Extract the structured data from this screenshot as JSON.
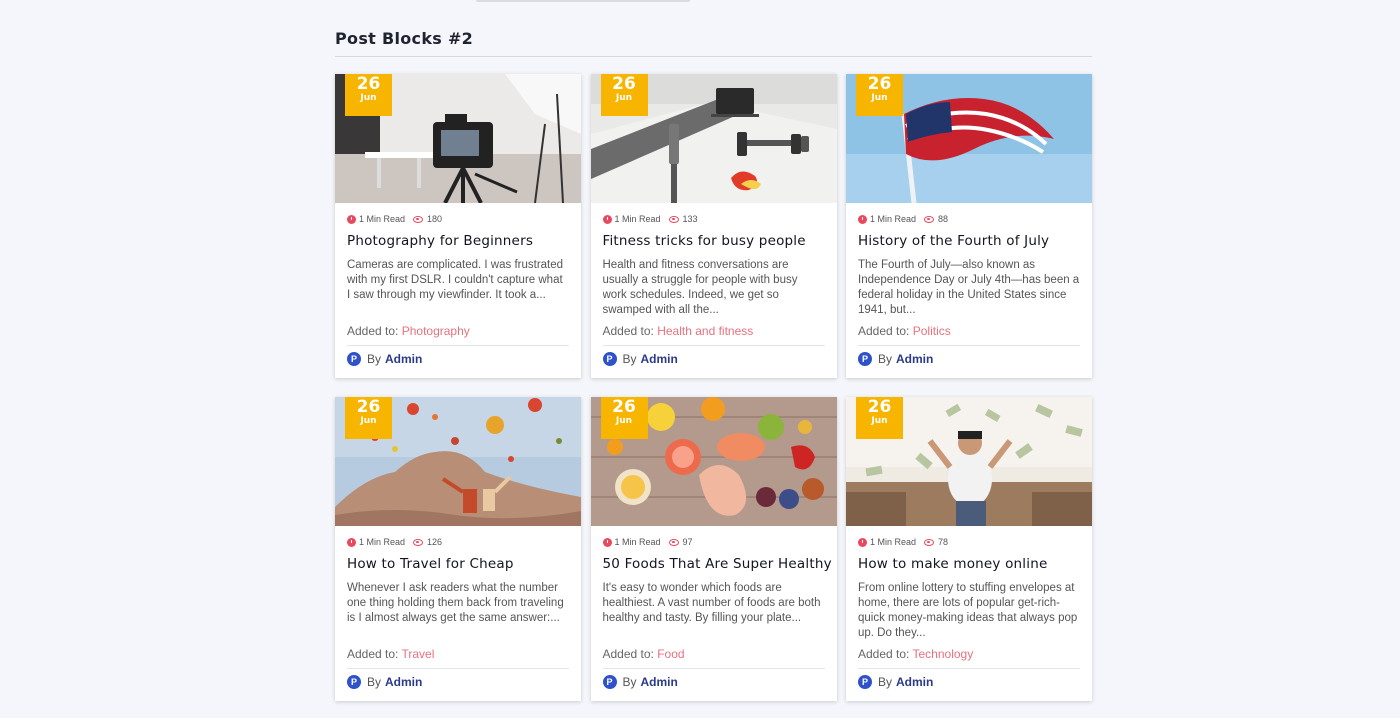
{
  "section": {
    "title": "Post Blocks #2"
  },
  "posts": [
    {
      "day": "26",
      "month": "Jun",
      "read": "1 Min Read",
      "views": "180",
      "title": "Photography for Beginners",
      "excerpt": "Cameras are complicated. I was frustrated with my first DSLR. I couldn't capture what I saw through my viewfinder. It took a...",
      "added_label": "Added to:",
      "category": "Photography",
      "by": "By",
      "author": "Admin",
      "avatar": "P"
    },
    {
      "day": "26",
      "month": "Jun",
      "read": "1 Min Read",
      "views": "133",
      "title": "Fitness tricks for busy people",
      "excerpt": "Health and fitness conversations are usually a struggle for people with busy work schedules. Indeed, we get so swamped with all the...",
      "added_label": "Added to:",
      "category": "Health and fitness",
      "by": "By",
      "author": "Admin",
      "avatar": "P"
    },
    {
      "day": "26",
      "month": "Jun",
      "read": "1 Min Read",
      "views": "88",
      "title": "History of the Fourth of July",
      "excerpt": "The Fourth of July—also known as Independence Day or July 4th—has been a federal holiday in the United States since 1941, but...",
      "added_label": "Added to:",
      "category": "Politics",
      "by": "By",
      "author": "Admin",
      "avatar": "P"
    },
    {
      "day": "26",
      "month": "Jun",
      "read": "1 Min Read",
      "views": "126",
      "title": "How to Travel for Cheap",
      "excerpt": "Whenever I ask readers what the number one thing holding them back from traveling is I almost always get the same answer:...",
      "added_label": "Added to:",
      "category": "Travel",
      "by": "By",
      "author": "Admin",
      "avatar": "P"
    },
    {
      "day": "26",
      "month": "Jun",
      "read": "1 Min Read",
      "views": "97",
      "title": "50 Foods That Are Super Healthy",
      "excerpt": "It's easy to wonder which foods are healthiest. A vast number of foods are both healthy and tasty. By filling your plate...",
      "added_label": "Added to:",
      "category": "Food",
      "by": "By",
      "author": "Admin",
      "avatar": "P"
    },
    {
      "day": "26",
      "month": "Jun",
      "read": "1 Min Read",
      "views": "78",
      "title": "How to make money online",
      "excerpt": "From online lottery to stuffing envelopes at home, there are lots of popular get-rich-quick money-making ideas that always pop up. Do they...",
      "added_label": "Added to:",
      "category": "Technology",
      "by": "By",
      "author": "Admin",
      "avatar": "P"
    }
  ],
  "colors": {
    "accent": "#f7b500",
    "category": "#e9717e",
    "author": "#2b3a8a",
    "icon": "#e9485e"
  },
  "icons": {
    "read": "clock-icon",
    "views": "eye-icon"
  }
}
